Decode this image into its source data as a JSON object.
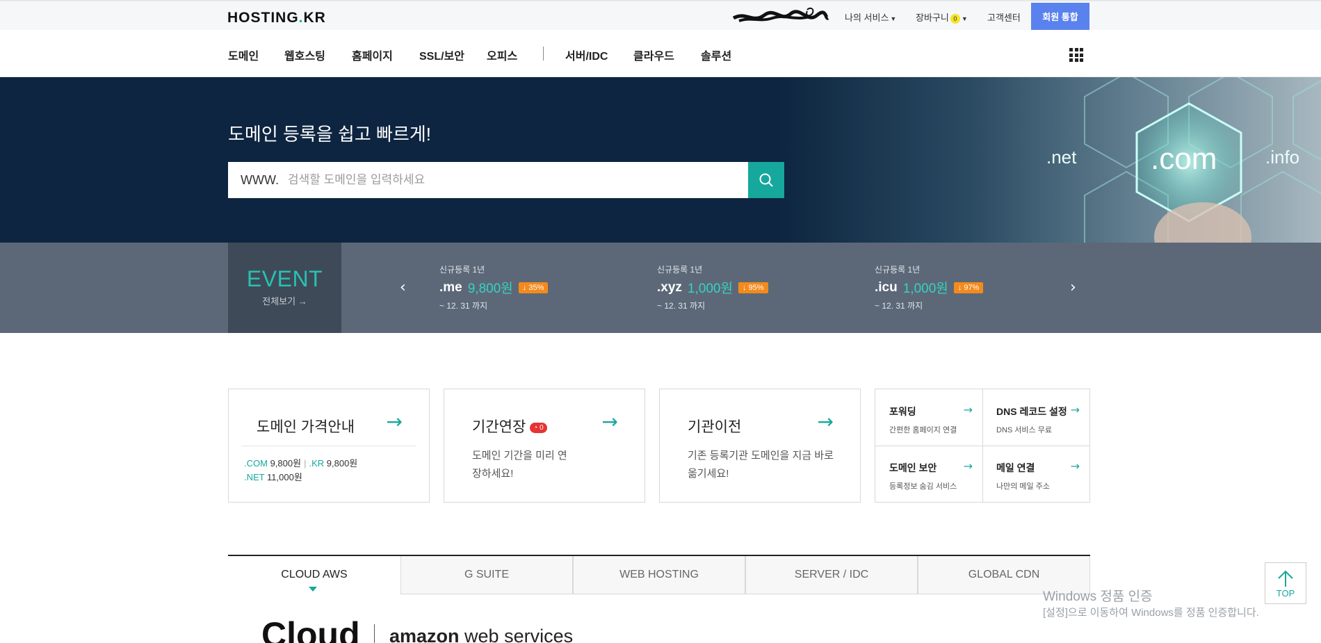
{
  "header": {
    "logo": "HOSTING.KR",
    "logo_main": "HOSTING",
    "logo_dot": ".",
    "logo_end": "KR",
    "my_services": "나의 서비스",
    "cart": "장바구니",
    "cart_count": "0",
    "support": "고객센터",
    "join": "회원 통합"
  },
  "nav": {
    "items": [
      "도메인",
      "웹호스팅",
      "홈페이지",
      "SSL/보안",
      "오피스",
      "서버/IDC",
      "클라우드",
      "솔루션"
    ]
  },
  "hero": {
    "title": "도메인 등록을 쉽고 빠르게!",
    "search_prefix": "WWW.",
    "search_placeholder": "검색할 도메인을 입력하세요",
    "tlds": [
      ".net",
      ".com",
      ".info"
    ]
  },
  "event": {
    "title": "EVENT",
    "view_all": "전체보기",
    "promos": [
      {
        "label": "신규등록 1년",
        "tld": ".me",
        "price": "9,800원",
        "discount": "↓ 35%",
        "until": "~ 12. 31 까지"
      },
      {
        "label": "신규등록 1년",
        "tld": ".xyz",
        "price": "1,000원",
        "discount": "↓ 95%",
        "until": "~ 12. 31 까지"
      },
      {
        "label": "신규등록 1년",
        "tld": ".icu",
        "price": "1,000원",
        "discount": "↓ 97%",
        "until": "~ 12. 31 까지"
      }
    ]
  },
  "cards": {
    "pricing": {
      "title": "도메인 가격안내",
      "com_label": ".COM",
      "com_price": "9,800원",
      "kr_label": ".KR",
      "kr_price": "9,800원",
      "net_label": ".NET",
      "net_price": "11,000원"
    },
    "renewal": {
      "title": "기간연장",
      "badge": "0",
      "desc": "도메인 기간을 미리 연장하세요!"
    },
    "transfer": {
      "title": "기관이전",
      "desc": "기존 등록기관 도메인을 지금 바로 옮기세요!"
    },
    "mini": [
      {
        "title": "포워딩",
        "desc": "간편한 홈페이지 연결"
      },
      {
        "title": "DNS 레코드 설정",
        "desc": "DNS 서비스 무료"
      },
      {
        "title": "도메인 보안",
        "desc": "등록정보 숨김 서비스"
      },
      {
        "title": "메일 연결",
        "desc": "나만의 메일 주소"
      }
    ]
  },
  "tabs": [
    "CLOUD AWS",
    "G SUITE",
    "WEB HOSTING",
    "SERVER / IDC",
    "GLOBAL CDN"
  ],
  "cloud": {
    "heading": "Cloud",
    "aws_bold": "amazon",
    "aws_rest": "web services"
  },
  "watermark": {
    "line1": "Windows 정품 인증",
    "line2": "[설정]으로 이동하여 Windows를 정품 인증합니다."
  },
  "top_button": "TOP",
  "colors": {
    "accent": "#16a89c",
    "hero_bg": "#0d2540",
    "event_bg": "#5c6878",
    "join_btn": "#5a82ee",
    "discount": "#f48a1c"
  }
}
